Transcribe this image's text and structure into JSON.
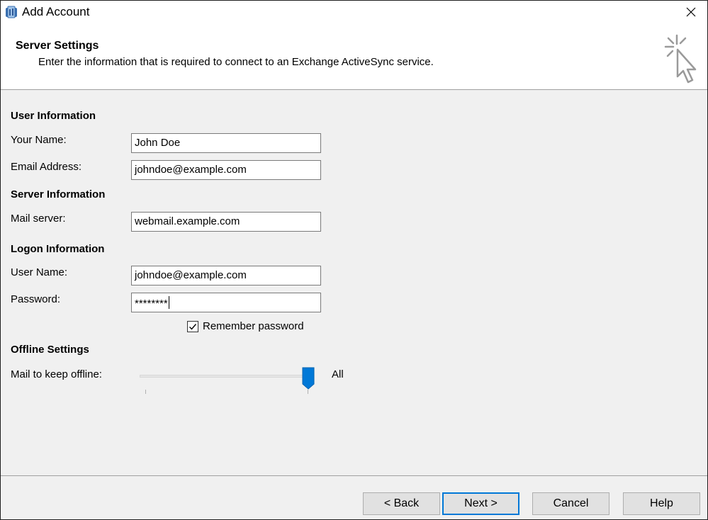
{
  "window": {
    "title": "Add Account"
  },
  "header": {
    "title": "Server Settings",
    "subtitle": "Enter the information that is required to connect to an Exchange ActiveSync service."
  },
  "user_info": {
    "heading": "User Information",
    "name_label": "Your Name:",
    "name_value": "John Doe",
    "email_label": "Email Address:",
    "email_value": "johndoe@example.com"
  },
  "server_info": {
    "heading": "Server Information",
    "mail_server_label": "Mail server:",
    "mail_server_value": "webmail.example.com"
  },
  "logon_info": {
    "heading": "Logon Information",
    "username_label": "User Name:",
    "username_value": "johndoe@example.com",
    "password_label": "Password:",
    "password_value": "********",
    "remember_label": "Remember password",
    "remember_checked": true
  },
  "offline": {
    "heading": "Offline Settings",
    "mail_offline_label": "Mail to keep offline:",
    "slider_value_label": "All",
    "slider_level": 1.0
  },
  "buttons": {
    "back": "< Back",
    "next": "Next >",
    "cancel": "Cancel",
    "help": "Help"
  },
  "icons": {
    "app": "outlook-icon",
    "close": "close-icon",
    "header": "cursor-click-icon",
    "check": "checkmark-icon"
  },
  "colors": {
    "accent": "#0078d7",
    "background": "#f0f0f0"
  }
}
